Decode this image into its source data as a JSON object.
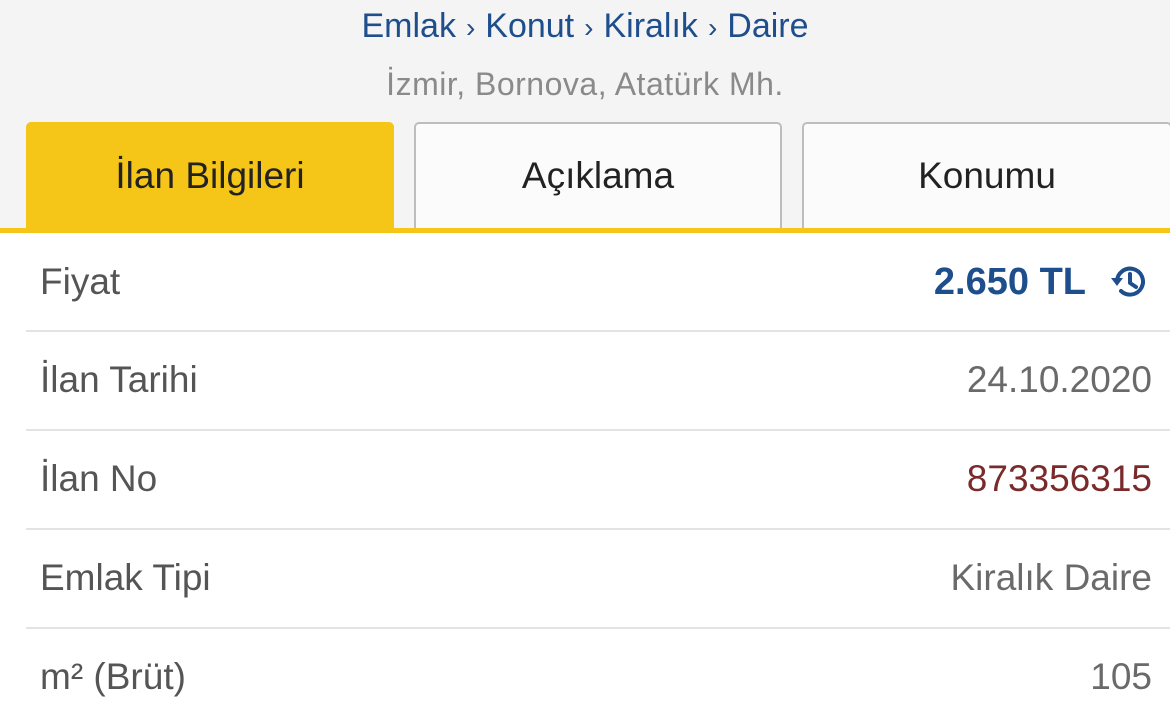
{
  "breadcrumb": {
    "items": [
      "Emlak",
      "Konut",
      "Kiralık",
      "Daire"
    ],
    "separator": "›"
  },
  "location": "İzmir, Bornova, Atatürk Mh.",
  "tabs": [
    {
      "label": "İlan Bilgileri",
      "active": true
    },
    {
      "label": "Açıklama",
      "active": false
    },
    {
      "label": "Konumu",
      "active": false
    }
  ],
  "details": {
    "price": {
      "label": "Fiyat",
      "value": "2.650 TL",
      "icon": "price-history-icon"
    },
    "listing_date": {
      "label": "İlan Tarihi",
      "value": "24.10.2020"
    },
    "listing_no": {
      "label": "İlan No",
      "value": "873356315"
    },
    "property_type": {
      "label": "Emlak Tipi",
      "value": "Kiralık Daire"
    },
    "gross_area": {
      "label": "m² (Brüt)",
      "value": "105"
    }
  },
  "colors": {
    "accent": "#f5c518",
    "link": "#1f4e8c",
    "listing_no": "#7a2a2a"
  }
}
